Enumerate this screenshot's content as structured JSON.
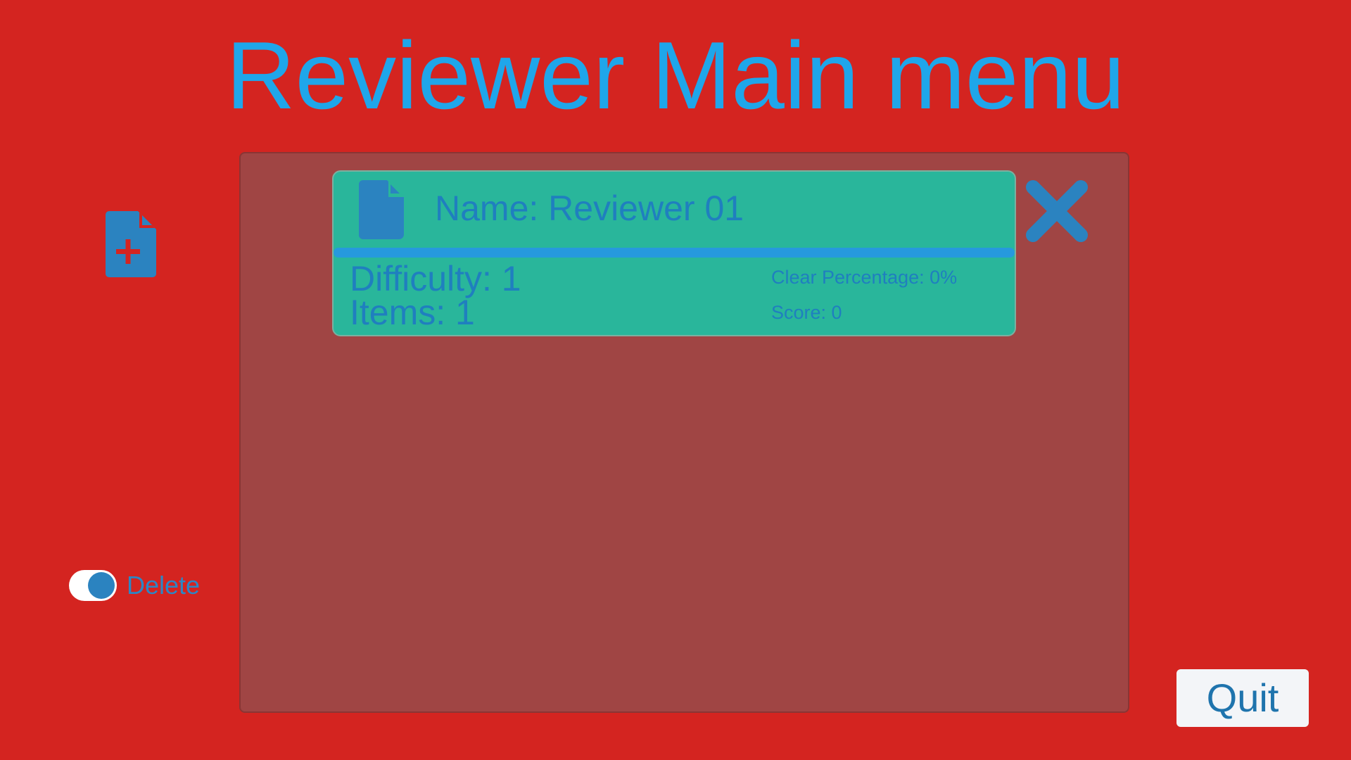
{
  "header": {
    "title": "Reviewer Main menu"
  },
  "sidebar": {
    "add_icon": "add-file-icon",
    "toggle": {
      "label": "Delete",
      "checked": true
    }
  },
  "reviewers": [
    {
      "icon": "file-icon",
      "name": "Name: Reviewer 01",
      "difficulty": "Difficulty: 1",
      "items": "Items: 1",
      "clear_percentage": "Clear Percentage: 0%",
      "score": "Score: 0"
    }
  ],
  "actions": {
    "close_icon": "close-icon",
    "quit_label": "Quit"
  },
  "colors": {
    "background": "#d42420",
    "title": "#1fa6ea",
    "panel": "#a04544",
    "card": "#29b69b",
    "card_divider": "#2699dd",
    "card_text": "#1f7fbf",
    "icon": "#2b83c0",
    "quit_bg": "#f3f5f8"
  }
}
